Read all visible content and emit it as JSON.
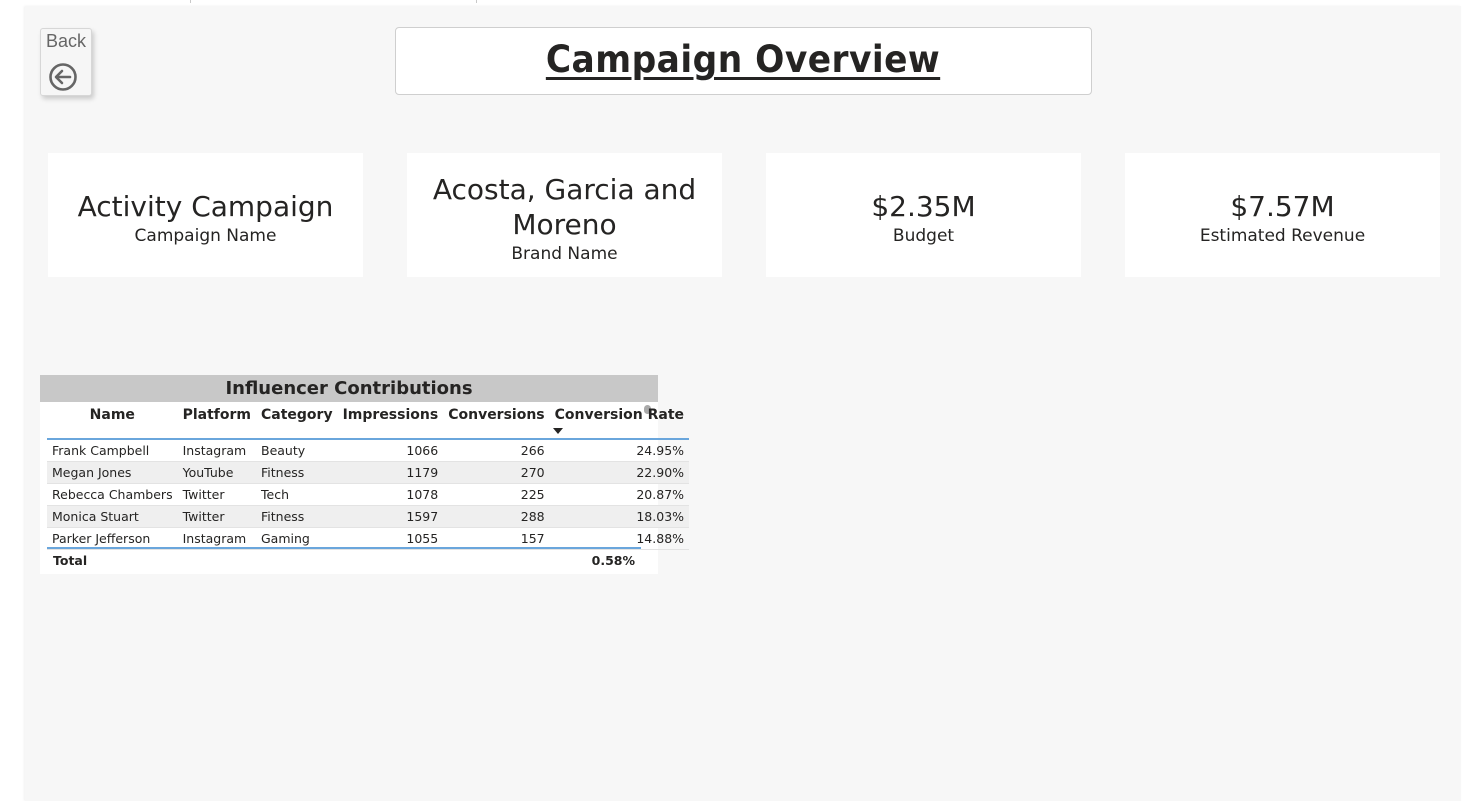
{
  "page": {
    "title": "Campaign Overview"
  },
  "back_button": {
    "label": "Back",
    "icon": "arrow-left-circle-icon"
  },
  "cards": [
    {
      "value": "Activity Campaign",
      "label": "Campaign Name"
    },
    {
      "value": "Acosta, Garcia and Moreno",
      "label": "Brand Name"
    },
    {
      "value": "$2.35M",
      "label": "Budget"
    },
    {
      "value": "$7.57M",
      "label": "Estimated Revenue"
    }
  ],
  "table": {
    "title": "Influencer Contributions",
    "columns": [
      "Name",
      "Platform",
      "Category",
      "Impressions",
      "Conversions",
      "Conversion Rate"
    ],
    "sorted_column": "Conversion Rate",
    "sort_direction": "descending",
    "rows": [
      [
        "Frank Campbell",
        "Instagram",
        "Beauty",
        "1066",
        "266",
        "24.95%"
      ],
      [
        "Megan Jones",
        "YouTube",
        "Fitness",
        "1179",
        "270",
        "22.90%"
      ],
      [
        "Rebecca Chambers",
        "Twitter",
        "Tech",
        "1078",
        "225",
        "20.87%"
      ],
      [
        "Monica Stuart",
        "Twitter",
        "Fitness",
        "1597",
        "288",
        "18.03%"
      ],
      [
        "Parker Jefferson",
        "Instagram",
        "Gaming",
        "1055",
        "157",
        "14.88%"
      ]
    ],
    "total": {
      "label": "Total",
      "value": "0.58%"
    }
  },
  "colors": {
    "canvas_bg": "#f7f7f7",
    "card_bg": "#ffffff",
    "table_header_bg": "#c8c8c8",
    "accent_line": "#6aa6dc",
    "text": "#252423"
  }
}
